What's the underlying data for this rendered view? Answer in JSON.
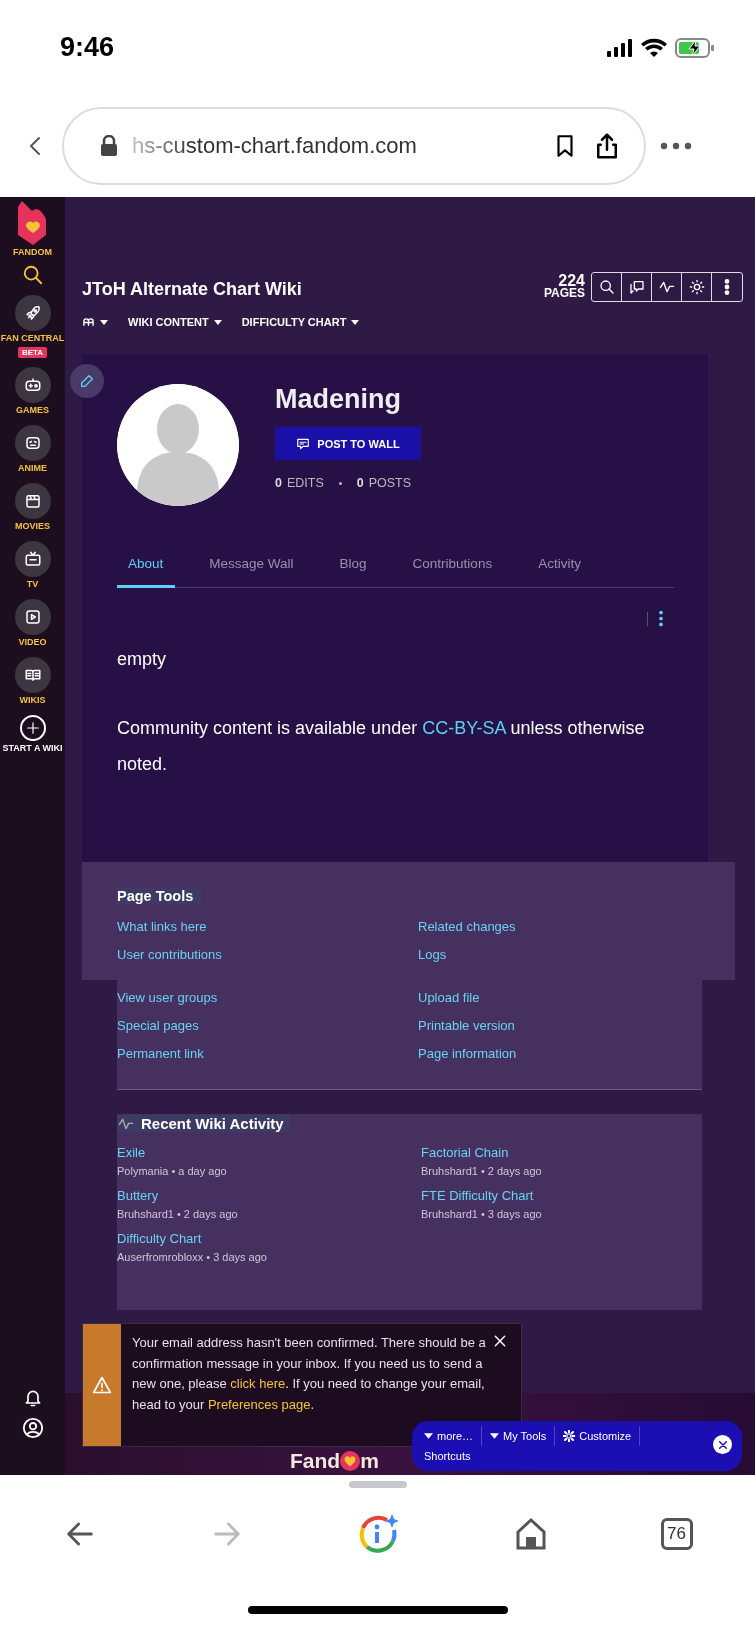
{
  "status_bar": {
    "time": "9:46"
  },
  "browser": {
    "url": "hs-custom-chart.fandom.com",
    "tab_count": "76"
  },
  "sidebar": {
    "brand": "FANDOM",
    "items": [
      {
        "label": "FAN CENTRAL",
        "badge": "BETA"
      },
      {
        "label": "GAMES"
      },
      {
        "label": "ANIME"
      },
      {
        "label": "MOVIES"
      },
      {
        "label": "TV"
      },
      {
        "label": "VIDEO"
      },
      {
        "label": "WIKIS"
      },
      {
        "label": "START A WIKI"
      }
    ]
  },
  "wiki": {
    "title": "JToH Alternate Chart Wiki",
    "nav": [
      "WIKI CONTENT",
      "DIFFICULTY CHART"
    ],
    "page_count": "224",
    "page_count_label": "PAGES"
  },
  "profile": {
    "username": "Madening",
    "post_button": "POST TO WALL",
    "edits_count": "0",
    "edits_label": "EDITS",
    "posts_count": "0",
    "posts_label": "POSTS"
  },
  "tabs": [
    {
      "label": "About",
      "selected": true
    },
    {
      "label": "Message Wall",
      "selected": false
    },
    {
      "label": "Blog",
      "selected": false
    },
    {
      "label": "Contributions",
      "selected": false
    },
    {
      "label": "Activity",
      "selected": false
    }
  ],
  "content": {
    "body": "empty",
    "license_before": "Community content is available under",
    "license_link": "CC-BY-SA",
    "license_after": "unless otherwise noted."
  },
  "page_tools": {
    "title": "Page Tools",
    "links": [
      "What links here",
      "Related changes",
      "User contributions",
      "Logs",
      "View user groups",
      "Upload file",
      "Special pages",
      "Printable version",
      "Permanent link",
      "Page information"
    ]
  },
  "recent_activity": {
    "title": "Recent Wiki Activity",
    "items": [
      {
        "page": "Exile",
        "meta": "Polymania • a day ago"
      },
      {
        "page": "Factorial Chain",
        "meta": "Bruhshard1 • 2 days ago"
      },
      {
        "page": "Buttery",
        "meta": "Bruhshard1 • 2 days ago"
      },
      {
        "page": "FTE Difficulty Chart",
        "meta": "Bruhshard1 • 3 days ago"
      },
      {
        "page": "Difficulty Chart",
        "meta": "Auserfromrobloxx • 3 days ago"
      }
    ]
  },
  "email_notice": {
    "text_1": "Your email address hasn't been confirmed. There should be a confirmation message in your inbox. If you need us to send a new one, please ",
    "link_1": "click here",
    "text_2": ". If you need to change your email, head to your ",
    "link_2": "Preferences page",
    "text_3": "."
  },
  "footer": {
    "logo_before": "Fand",
    "logo_after": "m"
  },
  "toolbar": {
    "items": [
      {
        "label": "more…",
        "kind": "menu"
      },
      {
        "label": "My Tools",
        "kind": "menu"
      },
      {
        "label": "Customize",
        "kind": "settings"
      }
    ],
    "shortcuts": "Shortcuts"
  }
}
